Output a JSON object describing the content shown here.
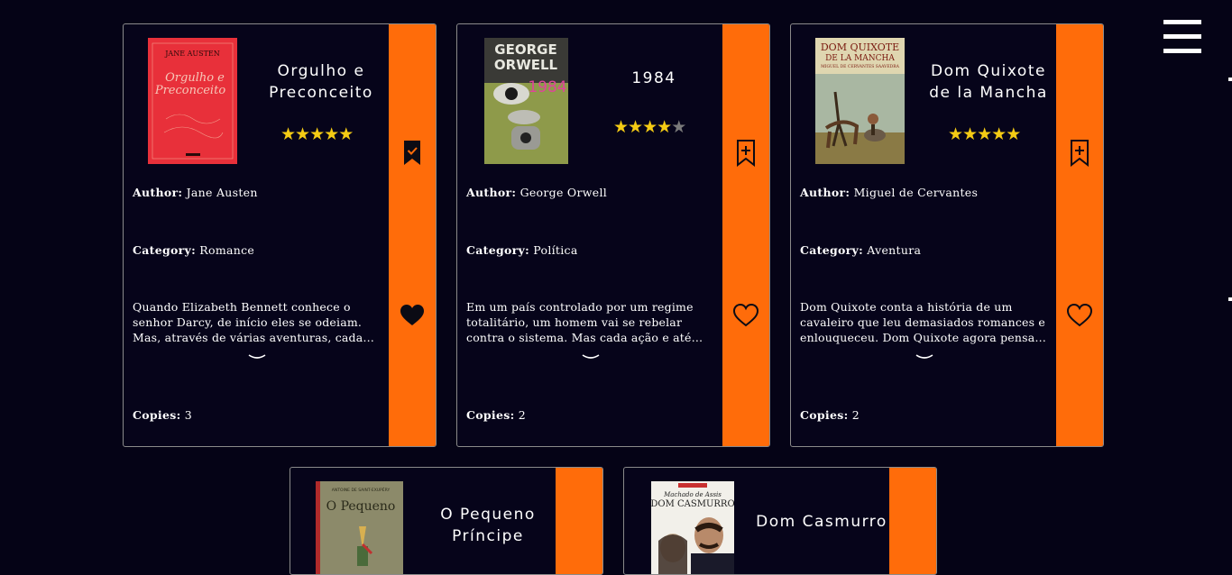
{
  "labels": {
    "author": "Author:",
    "category": "Category:",
    "copies": "Copies:"
  },
  "colors": {
    "background": "#050316",
    "accent": "#ff6c0a",
    "star": "#f4cb14"
  },
  "books": [
    {
      "title_lines": [
        "Orgulho e",
        "Preconceito"
      ],
      "rating": 5,
      "author": "Jane Austen",
      "category": "Romance",
      "description": "Quando Elizabeth Bennett conhece o senhor Darcy, de início eles se odeiam. Mas, através de várias aventuras, cada…",
      "copies": "3",
      "cover_text": [
        "JANE AUSTEN",
        "Orgulho e",
        "Preconceito"
      ],
      "bookmarked": true,
      "favorited": true
    },
    {
      "title_lines": [
        "1984"
      ],
      "rating": 4,
      "author": "George Orwell",
      "category": "Política",
      "description": "Em um país controlado por um regime totalitário, um homem vai se rebelar contra o sistema. Mas cada ação e até…",
      "copies": "2",
      "cover_text": [
        "GEORGE",
        "ORWELL",
        "1984"
      ],
      "bookmarked": false,
      "favorited": false
    },
    {
      "title_lines": [
        "Dom Quixote",
        "de la Mancha"
      ],
      "rating": 5,
      "author": "Miguel de Cervantes",
      "category": "Aventura",
      "description": "Dom Quixote conta a história de um cavaleiro que leu demasiados romances e enlouqueceu. Dom Quixote agora pensa…",
      "copies": "2",
      "cover_text": [
        "DOM QUIXOTE",
        "DE LA MANCHA",
        "MIGUEL DE CERVANTES SAAVEDRA"
      ],
      "bookmarked": false,
      "favorited": false
    },
    {
      "title_lines": [
        "O Pequeno",
        "Príncipe"
      ],
      "cover_text": [
        "ANTOINE DE SAINT-EXUPÉRY",
        "O Pequeno"
      ]
    },
    {
      "title_lines": [
        "Dom Casmurro"
      ],
      "cover_text": [
        "Machado de Assis",
        "DOM CASMURRO"
      ]
    }
  ]
}
